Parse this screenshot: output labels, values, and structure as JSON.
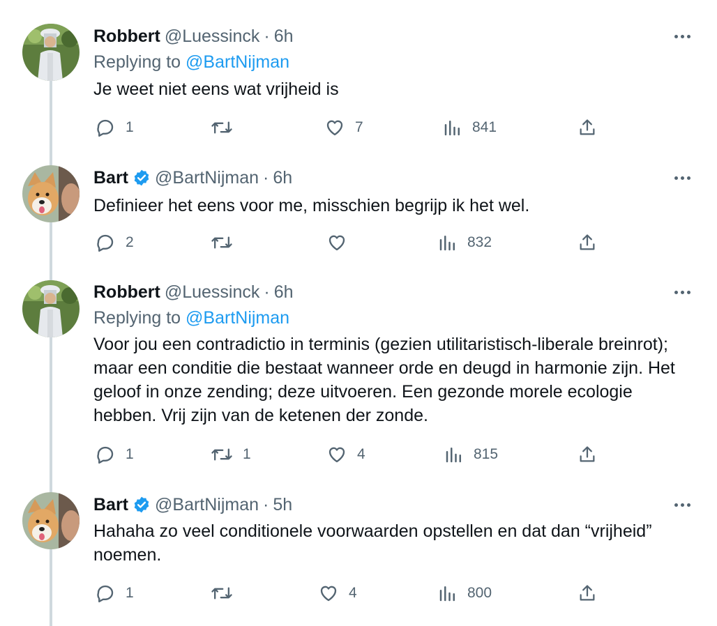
{
  "tweets": [
    {
      "name": "Robbert",
      "handle": "@Luessinck",
      "sep": "·",
      "time": "6h",
      "verified": false,
      "replying_prefix": "Replying to",
      "replying_to": "@BartNijman",
      "text": "Je weet niet eens wat vrijheid is",
      "replies": "1",
      "retweets": "",
      "likes": "7",
      "views": "841"
    },
    {
      "name": "Bart",
      "handle": "@BartNijman",
      "sep": "·",
      "time": "6h",
      "verified": true,
      "replying_prefix": "",
      "replying_to": "",
      "text": "Definieer het eens voor me, misschien begrijp ik het wel.",
      "replies": "2",
      "retweets": "",
      "likes": "",
      "views": "832"
    },
    {
      "name": "Robbert",
      "handle": "@Luessinck",
      "sep": "·",
      "time": "6h",
      "verified": false,
      "replying_prefix": "Replying to",
      "replying_to": "@BartNijman",
      "text": "Voor jou een contradictio in terminis (gezien utilitaristisch-liberale breinrot); maar een conditie die bestaat wanneer orde en deugd in harmonie zijn. Het geloof in onze zending; deze uitvoeren. Een gezonde morele ecologie hebben. Vrij zijn van de ketenen der zonde.",
      "replies": "1",
      "retweets": "1",
      "likes": "4",
      "views": "815"
    },
    {
      "name": "Bart",
      "handle": "@BartNijman",
      "sep": "·",
      "time": "5h",
      "verified": true,
      "replying_prefix": "",
      "replying_to": "",
      "text": "Hahaha zo veel conditionele voorwaarden opstellen en dat dan “vrijheid” noemen.",
      "replies": "1",
      "retweets": "",
      "likes": "4",
      "views": "800"
    }
  ],
  "icons": {
    "reply": "reply-icon",
    "retweet": "retweet-icon",
    "like": "heart-icon",
    "views": "views-icon",
    "share": "share-icon",
    "more": "more-icon",
    "verified": "verified-badge-icon"
  },
  "colors": {
    "text": "#0f1419",
    "secondary": "#536471",
    "link": "#1d9bf0",
    "thread_line": "#cfd9de"
  }
}
